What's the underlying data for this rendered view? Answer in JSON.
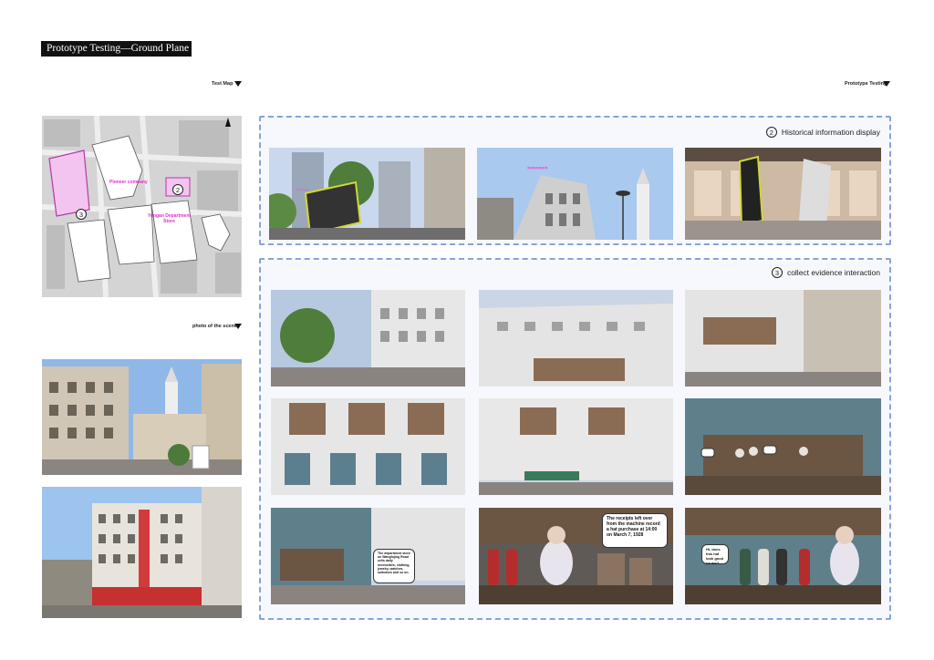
{
  "title": "Prototype Testing—Ground Plane",
  "labels": {
    "test_map": "Test Map",
    "prototype_testing": "Prototype Testing",
    "photo_scene": "photo of the  scene"
  },
  "map": {
    "marker_2": "2",
    "marker_3": "3",
    "pioneer": "Pioneer company",
    "yongan": "Yongan Department Store"
  },
  "sections": {
    "historical": {
      "num": "2",
      "label": "Historical information display"
    },
    "evidence": {
      "num": "3",
      "label": "collect evidence interaction"
    }
  },
  "speech": {
    "a": "The department store on Wangfujing Road sells daily necessities, clothing, jewelry, watches, suitcases and so on.",
    "b": "The receipts left over from the machine record a hat purchase at 14:00 on March 7, 1928",
    "c": "Hi, does this hat look good on me?"
  },
  "colors": {
    "accent": "#e85fd6",
    "panel_border": "#8aa2d8"
  }
}
